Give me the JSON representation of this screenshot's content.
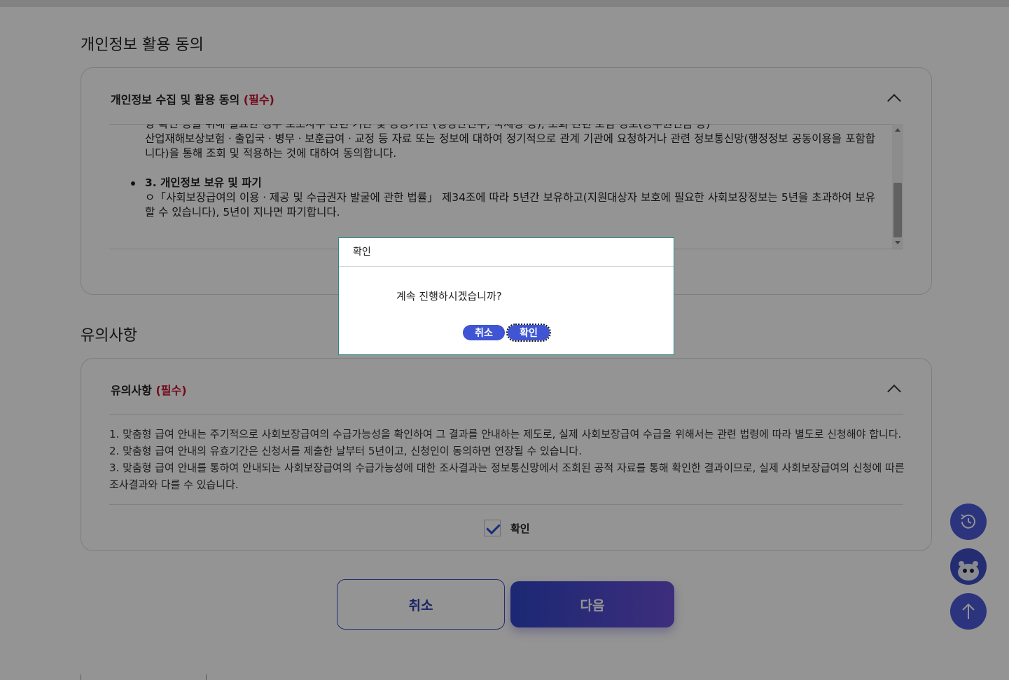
{
  "privacy": {
    "heading": "개인정보 활용 동의",
    "card_title": "개인정보 수집 및 활용 동의",
    "required": "(필수)",
    "terms_top_line": "향 확인 등을 위해 필요한 경우 보조사무 관련 기관 및 공공기관 (행정안전부, 국세청 등), 조회 관련 보험 정보(공무원연금 등)",
    "terms_para": "산업재해보상보험ㆍ출입국ㆍ병무ㆍ보훈급여ㆍ교정 등 자료 또는 정보에 대하여 정기적으로 관계 기관에 요청하거나 관련 정보통신망(행정정보 공동이용을 포함합니다)을 통해 조회 및 적용하는 것에 대하여 동의합니다.",
    "bullet_title": "3. 개인정보 보유 및 파기",
    "bullet_text": "ㅇ「사회보장급여의 이용ㆍ제공 및 수급권자 발굴에 관한 법률」 제34조에 따라 5년간 보유하고(지원대상자 보호에 필요한 사회보장정보는 5년을 초과하여 보유할 수 있습니다), 5년이 지나면 파기합니다."
  },
  "notice": {
    "heading": "유의사항",
    "card_title": "유의사항",
    "required": "(필수)",
    "items": [
      "1. 맞춤형 급여 안내는 주기적으로 사회보장급여의 수급가능성을 확인하여 그 결과를 안내하는 제도로, 실제 사회보장급여 수급을 위해서는 관련 법령에 따라 별도로 신청해야 합니다.",
      "2. 맞춤형 급여 안내의 유효기간은 신청서를 제출한 날부터 5년이고, 신청인이 동의하면 연장될 수 있습니다.",
      "3. 맞춤형 급여 안내를 통하여 안내되는 사회보장급여의 수급가능성에 대한 조사결과는 정보통신망에서 조회된 공적 자료를 통해 확인한 결과이므로, 실제 사회보장급여의 신청에 따른 조사결과와 다를 수 있습니다."
    ],
    "confirm_label": "확인",
    "confirm_checked": true
  },
  "buttons": {
    "cancel": "취소",
    "next": "다음"
  },
  "fab": {
    "history_icon": "history-icon",
    "chatbot_icon": "chatbot-mascot-icon",
    "top_icon": "arrow-up-icon"
  },
  "dialog": {
    "title": "확인",
    "message": "계속 진행하시겠습니까?",
    "cancel": "취소",
    "confirm": "확인"
  },
  "colors": {
    "accent": "#3f55d4",
    "required": "#c8102e",
    "dialog_border": "#2b8a8a"
  }
}
